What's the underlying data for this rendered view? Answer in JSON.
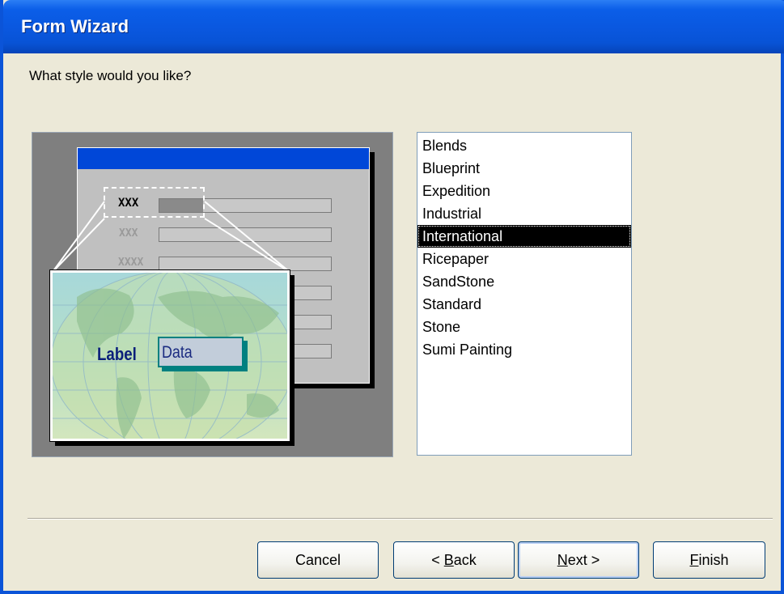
{
  "window": {
    "title": "Form Wizard"
  },
  "prompt": "What style would you like?",
  "preview": {
    "labels": [
      "XXX",
      "XXX",
      "XXXX"
    ],
    "zoom_label": "Label",
    "zoom_data": "Data"
  },
  "styles": {
    "items": [
      "Blends",
      "Blueprint",
      "Expedition",
      "Industrial",
      "International",
      "Ricepaper",
      "SandStone",
      "Standard",
      "Stone",
      "Sumi Painting"
    ],
    "selected": "International"
  },
  "buttons": {
    "cancel": "Cancel",
    "back_prefix": "< ",
    "back_accel": "B",
    "back_rest": "ack",
    "next_accel": "N",
    "next_rest": "ext >",
    "finish_accel": "F",
    "finish_rest": "inish"
  },
  "colors": {
    "titlebar": "#0a58e0",
    "selection": "#000000",
    "face": "#ece9d8"
  }
}
